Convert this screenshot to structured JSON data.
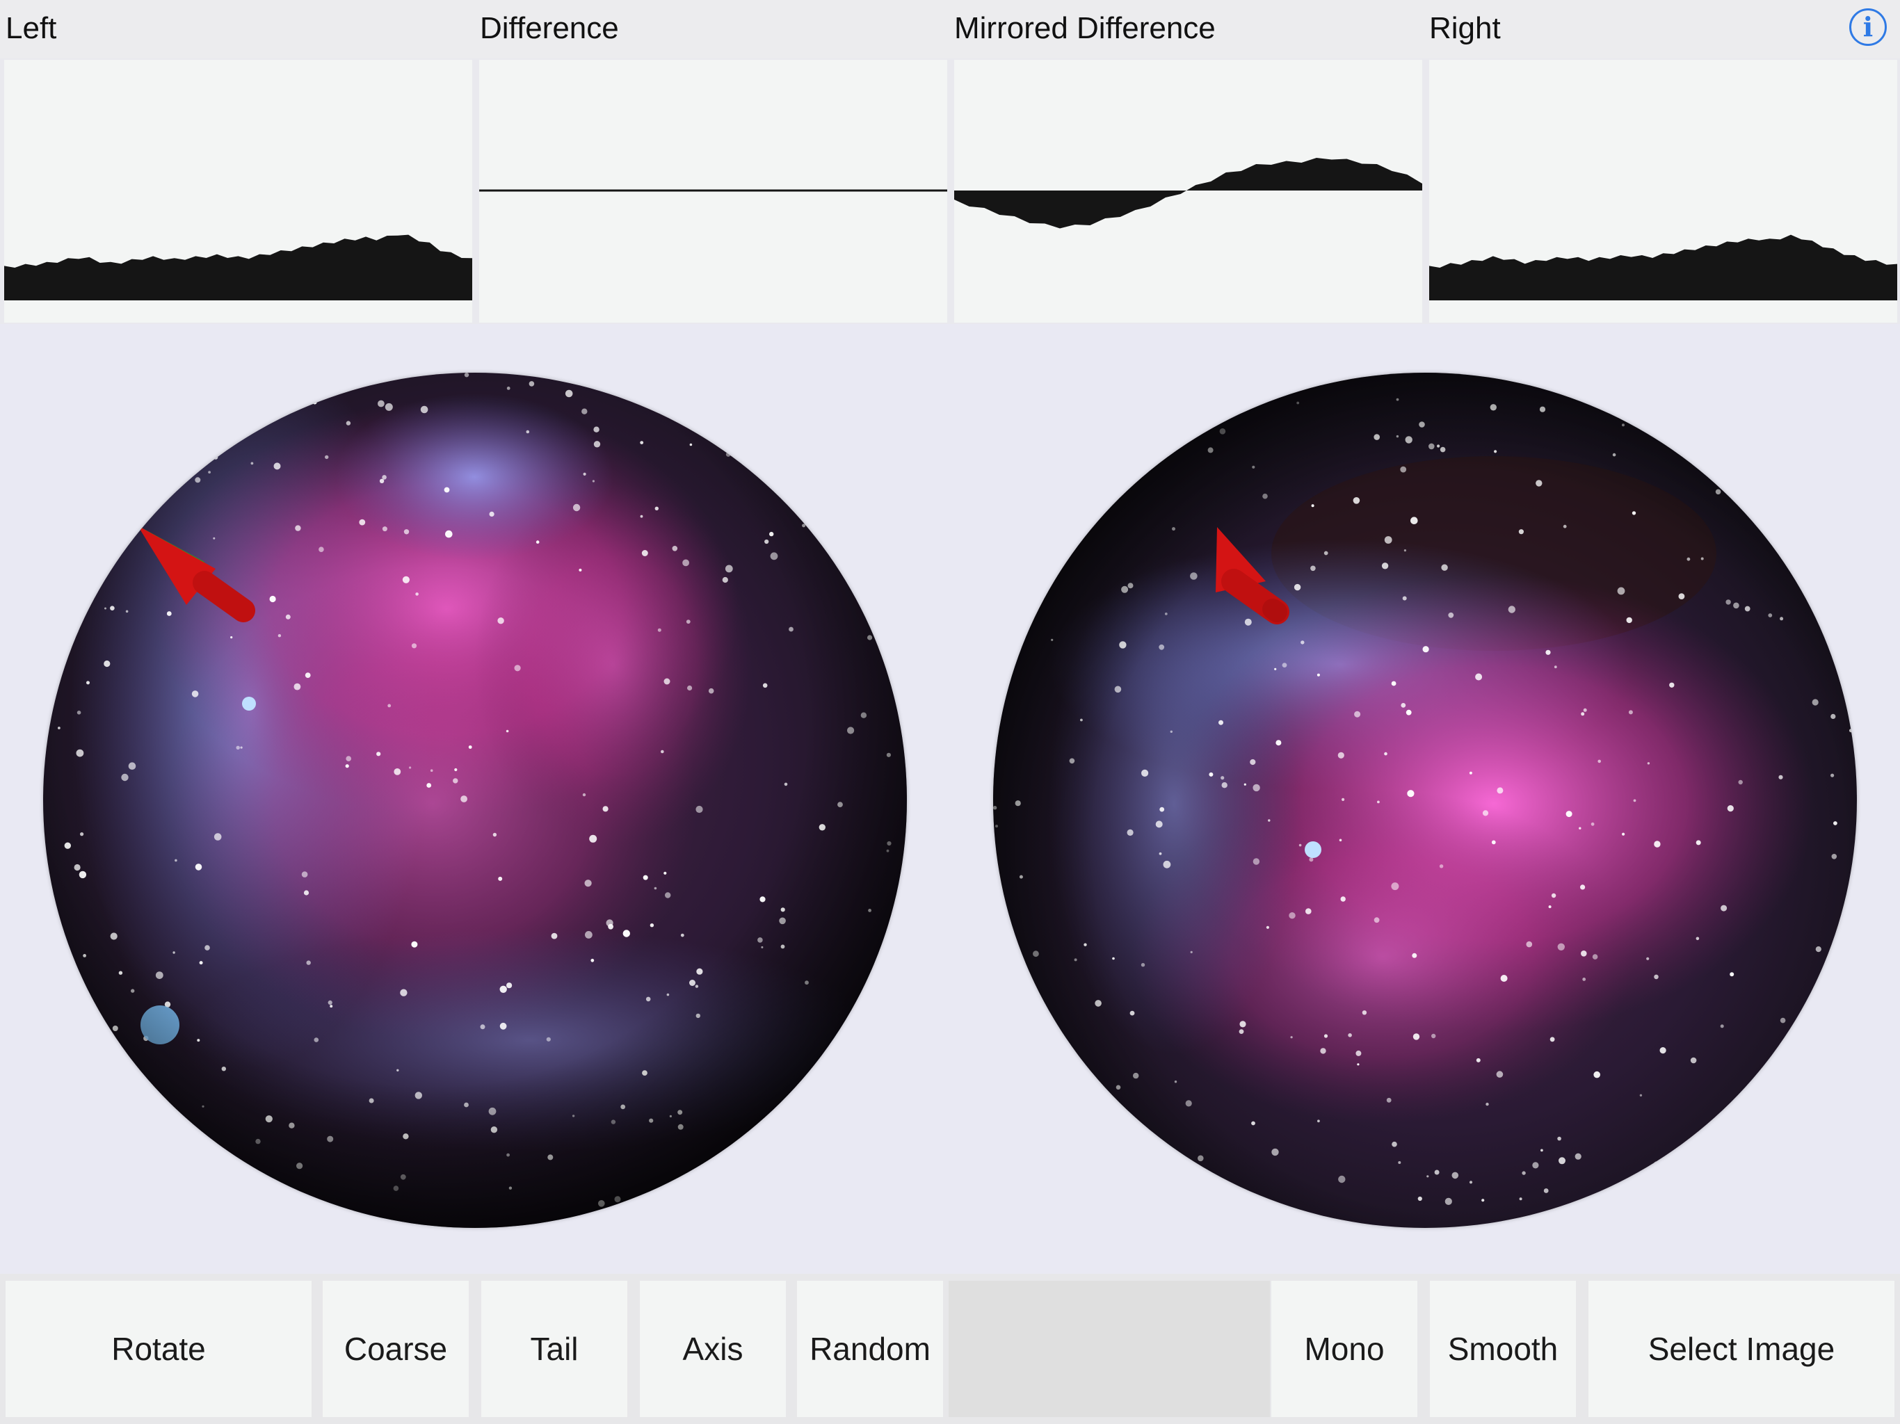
{
  "header": {
    "titles": [
      "Left",
      "Difference",
      "Mirrored Difference",
      "Right"
    ],
    "info_label": "i"
  },
  "graphs": {
    "left_profile": [
      34,
      35,
      36,
      37,
      38,
      40,
      42,
      44,
      43,
      40,
      38,
      39,
      41,
      43,
      44,
      43,
      42,
      43,
      44,
      45,
      46,
      45,
      44,
      44,
      46,
      48,
      50,
      52,
      54,
      56,
      58,
      60,
      62,
      63,
      64,
      63,
      65,
      68,
      66,
      62,
      58,
      52,
      48,
      45,
      42
    ],
    "difference_profile": [
      0,
      0,
      0,
      0,
      0,
      0,
      0,
      0,
      0,
      0,
      0,
      0,
      0,
      0,
      0,
      0,
      0,
      0,
      0,
      0
    ],
    "mirrored_difference_profile": [
      -10,
      -14,
      -18,
      -22,
      -26,
      -30,
      -33,
      -35,
      -34,
      -32,
      -28,
      -24,
      -20,
      -14,
      -8,
      -2,
      4,
      10,
      16,
      20,
      24,
      26,
      27,
      28,
      30,
      31,
      29,
      27,
      24,
      20,
      14,
      8
    ],
    "right_profile": [
      34,
      35,
      37,
      38,
      40,
      42,
      44,
      43,
      41,
      39,
      40,
      42,
      43,
      44,
      43,
      42,
      43,
      44,
      45,
      46,
      45,
      45,
      47,
      49,
      51,
      53,
      55,
      57,
      59,
      61,
      62,
      63,
      62,
      64,
      66,
      64,
      60,
      56,
      52,
      48,
      45,
      42,
      40,
      38,
      36
    ]
  },
  "spheres": {
    "left_name": "left-nebula-sphere",
    "right_name": "right-nebula-sphere",
    "arrow_color": "#cc1111",
    "arrow_side_color": "#22bb22"
  },
  "toolbar": {
    "rotate": "Rotate",
    "coarse": "Coarse",
    "tail": "Tail",
    "axis": "Axis",
    "random": "Random",
    "mono": "Mono",
    "smooth": "Smooth",
    "select_image": "Select Image"
  }
}
